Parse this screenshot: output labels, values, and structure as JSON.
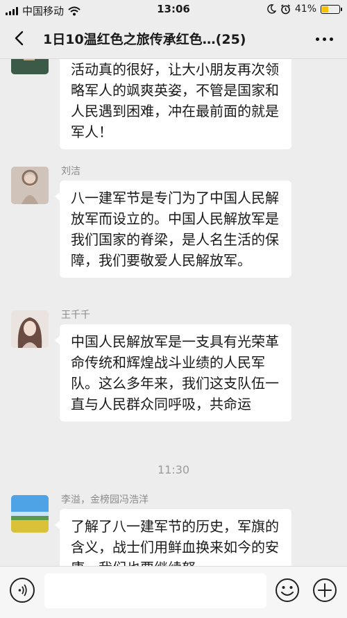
{
  "status": {
    "carrier": "中国移动",
    "time": "13:06",
    "battery": "41%",
    "battery_level": 0.41,
    "battery_color": "#f7c200"
  },
  "nav": {
    "title": "1日10温红色之旅传承红色…(25)",
    "back_icon": "chevron-left-icon",
    "more_icon": "more-dots-icon"
  },
  "messages": [
    {
      "sender": "",
      "text": "活动真的很好，让大小朋友再次领略军人的飒爽英姿，不管是国家和人民遇到困难，冲在最前面的就是军人！"
    },
    {
      "sender": "刘洁",
      "text": "八一建军节是专门为了中国人民解放军而设立的。中国人民解放军是我们国家的脊梁，是人名生活的保障，我们要敬爱人民解放军。"
    },
    {
      "sender": "王千千",
      "text": "中国人民解放军是一支具有光荣革命传统和辉煌战斗业绩的人民军队。这么多年来，我们这支队伍一直与人民群众同呼吸，共命运"
    },
    {
      "sender": "李溢，金榜园冯浩洋",
      "text": "了解了八一建军节的历史，军旗的含义，战士们用鲜血换来如今的安康，我们也要继续努"
    }
  ],
  "timestamp": "11:30",
  "input": {
    "voice_icon": "voice-icon",
    "emoji_icon": "emoji-icon",
    "plus_icon": "plus-icon"
  }
}
